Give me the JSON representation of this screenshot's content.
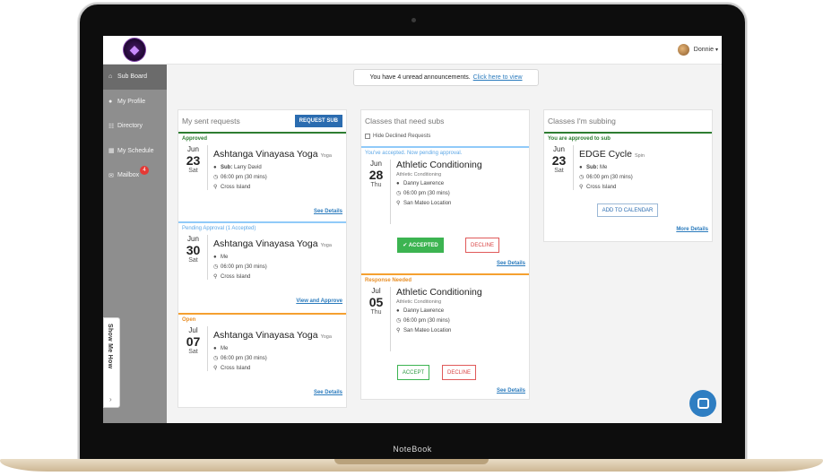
{
  "device": {
    "brand_label": "NoteBook"
  },
  "header": {
    "user_name": "Donnie",
    "caret": "▾"
  },
  "sidebar": {
    "items": [
      {
        "label": "Sub Board",
        "icon": "home-icon",
        "glyph": "⌂",
        "active": true
      },
      {
        "label": "My Profile",
        "icon": "user-icon",
        "glyph": "●"
      },
      {
        "label": "Directory",
        "icon": "users-icon",
        "glyph": "☷"
      },
      {
        "label": "My Schedule",
        "icon": "calendar-icon",
        "glyph": "▦"
      },
      {
        "label": "Mailbox",
        "icon": "mail-icon",
        "glyph": "✉",
        "badge": "4"
      }
    ],
    "show_me_how": "Show Me How",
    "show_me_chevron": "›"
  },
  "announcement": {
    "text": "You have 4 unread announcements.",
    "link": "Click here to view"
  },
  "sent_requests": {
    "title": "My sent requests",
    "button": "REQUEST SUB",
    "cards": [
      {
        "status": "Approved",
        "mon": "Jun",
        "day": "23",
        "dow": "Sat",
        "title": "Ashtanga Vinayasa Yoga",
        "cat": "Yoga",
        "sub_label": "Sub:",
        "sub_name": "Larry David",
        "time": "06:00 pm (30 mins)",
        "location": "Cross Island",
        "link": "See Details"
      },
      {
        "status": "Pending Approval (1 Accepted)",
        "mon": "Jun",
        "day": "30",
        "dow": "Sat",
        "title": "Ashtanga Vinayasa Yoga",
        "cat": "Yoga",
        "who": "Me",
        "time": "06:00 pm (30 mins)",
        "location": "Cross Island",
        "link": "View and Approve"
      },
      {
        "status": "Open",
        "mon": "Jul",
        "day": "07",
        "dow": "Sat",
        "title": "Ashtanga Vinayasa Yoga",
        "cat": "Yoga",
        "who": "Me",
        "time": "06:00 pm (30 mins)",
        "location": "Cross Island",
        "link": "See Details"
      }
    ]
  },
  "need_subs": {
    "title": "Classes that need subs",
    "hide_declined": "Hide Declined Requests",
    "cards": [
      {
        "status": "You've accepted. Now pending approval.",
        "mon": "Jun",
        "day": "28",
        "dow": "Thu",
        "title": "Athletic Conditioning",
        "sub": "Athletic Conditioning",
        "who": "Danny Lawrence",
        "time": "06:00 pm (30 mins)",
        "location": "San Mateo Location",
        "accept": "✔ ACCEPTED",
        "decline": "DECLINE",
        "link": "See Details"
      },
      {
        "status": "Response Needed",
        "mon": "Jul",
        "day": "05",
        "dow": "Thu",
        "title": "Athletic Conditioning",
        "sub": "Athletic Conditioning",
        "who": "Danny Lawrence",
        "time": "06:00 pm (30 mins)",
        "location": "San Mateo Location",
        "accept": "ACCEPT",
        "decline": "DECLINE",
        "link": "See Details"
      }
    ]
  },
  "subbing": {
    "title": "Classes I'm subbing",
    "cards": [
      {
        "status": "You are approved to sub",
        "mon": "Jun",
        "day": "23",
        "dow": "Sat",
        "title": "EDGE Cycle",
        "cat": "Spin",
        "sub_label": "Sub:",
        "sub_name": "Me",
        "time": "06:00 pm (30 mins)",
        "location": "Cross Island",
        "calendar": "ADD TO CALENDAR",
        "link": "More Details"
      }
    ]
  },
  "icons": {
    "person": "person-icon",
    "clock": "clock-icon",
    "pin": "map-pin-icon",
    "chat": "chat-icon",
    "logo": "logo-icon"
  }
}
